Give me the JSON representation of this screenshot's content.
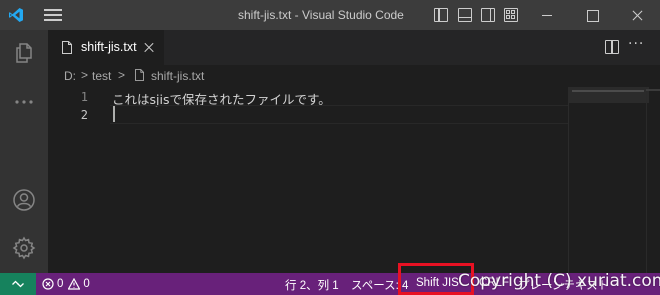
{
  "titlebar": {
    "title": "shift-jis.txt - Visual Studio Code"
  },
  "activity_bar": {
    "icons": [
      "files-icon",
      "more-icon",
      "account-icon",
      "gear-icon"
    ]
  },
  "tabs": [
    {
      "label": "shift-jis.txt",
      "icon": "file-icon",
      "active": true
    }
  ],
  "tab_actions": {
    "more_label": "···"
  },
  "breadcrumb": {
    "drive": "D:",
    "folder": "test",
    "file": "shift-jis.txt",
    "separator": ">"
  },
  "editor": {
    "line_numbers": [
      "1",
      "2"
    ],
    "lines": [
      "これはsjisで保存されたファイルです。",
      ""
    ]
  },
  "statusbar": {
    "problems_errors": "0",
    "problems_warnings": "0",
    "cursor_position": "行 2、列 1",
    "indent": "スペース: 4",
    "encoding": "Shift JIS",
    "eol": "CRLF",
    "language": "プレーンテキスト"
  },
  "watermark": "Copyright (C) xuriat.com",
  "colors": {
    "statusbar_bg": "#68217a",
    "remote_bg": "#16825d",
    "vscode_blue": "#23a9f2",
    "highlight": "#e81123"
  }
}
